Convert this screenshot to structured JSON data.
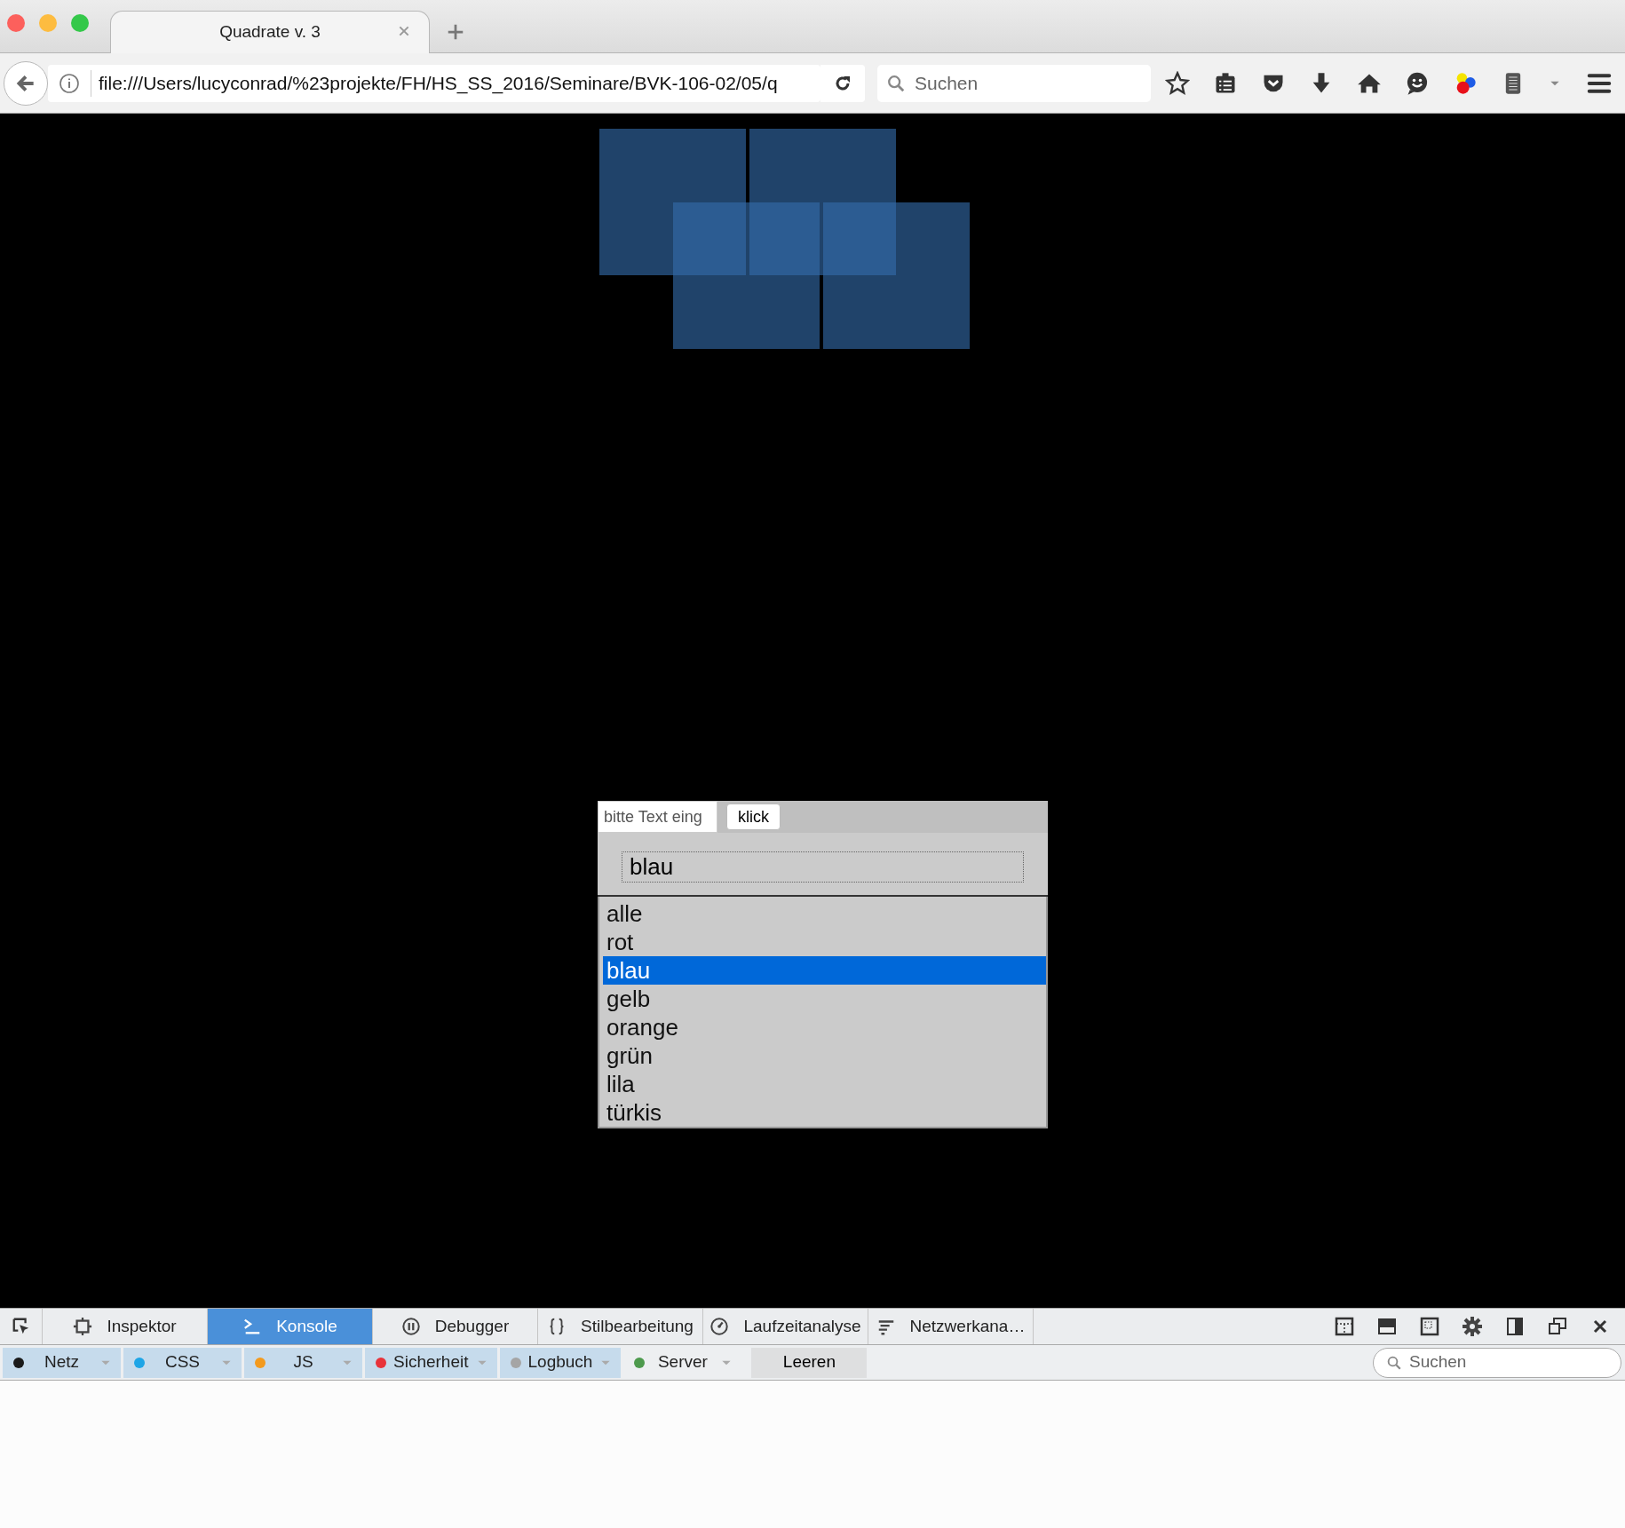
{
  "browser": {
    "tabs": [
      {
        "title": "Quadrate v. 3",
        "selected": true
      }
    ],
    "url": "file:///Users/lucyconrad/%23projekte/FH/HS_SS_2016/Seminare/BVK-106-02/05/q",
    "search": {
      "placeholder": "Suchen"
    }
  },
  "page": {
    "text_input": {
      "placeholder": "bitte Text eing"
    },
    "button": "klick",
    "value_field": {
      "value": "blau"
    },
    "list": [
      {
        "label": "alle",
        "selected": false
      },
      {
        "label": "rot",
        "selected": false
      },
      {
        "label": "blau",
        "selected": true
      },
      {
        "label": "gelb",
        "selected": false
      },
      {
        "label": "orange",
        "selected": false
      },
      {
        "label": "grün",
        "selected": false
      },
      {
        "label": "lila",
        "selected": false
      },
      {
        "label": "türkis",
        "selected": false
      }
    ]
  },
  "devtools": {
    "tabs": [
      {
        "label": "Inspektor",
        "selected": false
      },
      {
        "label": "Konsole",
        "selected": true
      },
      {
        "label": "Debugger",
        "selected": false
      },
      {
        "label": "Stilbearbeitung",
        "selected": false
      },
      {
        "label": "Laufzeitanalyse",
        "selected": false
      },
      {
        "label": "Netzwerkana…",
        "selected": false
      }
    ],
    "filters": [
      {
        "label": "Netz",
        "color": "#1a1a1a",
        "on": true
      },
      {
        "label": "CSS",
        "color": "#1ea5e6",
        "on": true
      },
      {
        "label": "JS",
        "color": "#f39a1e",
        "on": true
      },
      {
        "label": "Sicherheit",
        "color": "#e8333a",
        "on": true
      },
      {
        "label": "Logbuch",
        "color": "#a5a5a5",
        "on": true
      },
      {
        "label": "Server",
        "color": "#4d9a4d",
        "on": false
      }
    ],
    "clear_button": "Leeren",
    "search": {
      "placeholder": "Suchen"
    }
  }
}
